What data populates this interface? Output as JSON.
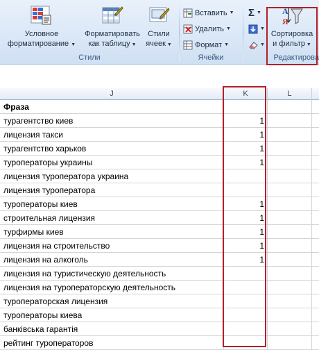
{
  "ribbon": {
    "styles": {
      "cond_format_label": "Условное форматирование",
      "cond_format_line1": "Условное",
      "cond_format_line2": "форматирование",
      "format_table_line1": "Форматировать",
      "format_table_line2": "как таблицу",
      "cell_styles_line1": "Стили",
      "cell_styles_line2": "ячеек",
      "group_label": "Стили"
    },
    "cells": {
      "insert_label": "Вставить",
      "delete_label": "Удалить",
      "format_label": "Формат",
      "group_label": "Ячейки"
    },
    "editing": {
      "sum_symbol": "Σ",
      "sort_line1": "Сортировка",
      "sort_line2": "и фильтр",
      "group_label": "Редактирова"
    }
  },
  "sheet": {
    "columns": [
      "J",
      "K",
      "L"
    ],
    "rows": [
      {
        "phrase": "Фраза",
        "k": ""
      },
      {
        "phrase": "турагентство киев",
        "k": "1"
      },
      {
        "phrase": "лицензия такси",
        "k": "1"
      },
      {
        "phrase": "турагентство харьков",
        "k": "1"
      },
      {
        "phrase": "туроператоры украины",
        "k": "1"
      },
      {
        "phrase": "лицензия туроператора украина",
        "k": ""
      },
      {
        "phrase": "лицензия туроператора",
        "k": ""
      },
      {
        "phrase": "туроператоры киев",
        "k": "1"
      },
      {
        "phrase": "строительная лицензия",
        "k": "1"
      },
      {
        "phrase": "турфирмы киев",
        "k": "1"
      },
      {
        "phrase": "лицензия на строительство",
        "k": "1"
      },
      {
        "phrase": "лицензия на алкоголь",
        "k": "1"
      },
      {
        "phrase": "лицензия на туристическую деятельность",
        "k": ""
      },
      {
        "phrase": "лицензия на туроператорскую деятельность",
        "k": ""
      },
      {
        "phrase": "туроператорская лицензия",
        "k": ""
      },
      {
        "phrase": "туроператоры киева",
        "k": ""
      },
      {
        "phrase": "банківська гарантія",
        "k": ""
      },
      {
        "phrase": "рейтинг туроператоров",
        "k": ""
      }
    ]
  },
  "colors": {
    "highlight": "#b0202a",
    "ribbon_bg": "#dbe8f7",
    "group_label": "#3b5a85"
  }
}
